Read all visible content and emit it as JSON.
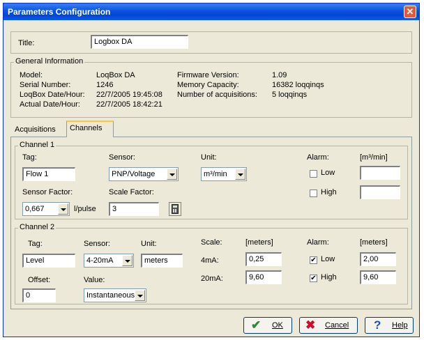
{
  "window": {
    "title": "Parameters Configuration"
  },
  "title_field": {
    "label": "Title:",
    "value": "Logbox DA"
  },
  "general": {
    "legend": "General Information",
    "model_label": "Model:",
    "model_value": "LoqBox DA",
    "serial_label": "Serial Number:",
    "serial_value": "1246",
    "logbox_dt_label": "LoqBox Date/Hour:",
    "logbox_dt_value": "22/7/2005 19:45:08",
    "actual_dt_label": "Actual Date/Hour:",
    "actual_dt_value": "22/7/2005 18:42:21",
    "firmware_label": "Firmware Version:",
    "firmware_value": "1.09",
    "memory_label": "Memory Capacity:",
    "memory_value": "16382 loqqinqs",
    "acq_label": "Number of acquisitions:",
    "acq_value": "5 loqqinqs"
  },
  "tabs": [
    {
      "label": "Acquisitions"
    },
    {
      "label": "Channels"
    }
  ],
  "channel1": {
    "legend": "Channel 1",
    "tag_label": "Tag:",
    "tag_value": "Flow 1",
    "sensor_label": "Sensor:",
    "sensor_value": "PNP/Voltage",
    "unit_label": "Unit:",
    "unit_value": "m³/min",
    "alarm_label": "Alarm:",
    "alarm_unit": "[m³/min]",
    "low_label": "Low",
    "low_value": "",
    "high_label": "High",
    "high_value": "",
    "sensor_factor_label": "Sensor Factor:",
    "sensor_factor_value": "0,667",
    "sensor_factor_unit": "l/pulse",
    "scale_factor_label": "Scale Factor:",
    "scale_factor_value": "3",
    "calc_icon": "calculator-icon"
  },
  "channel2": {
    "legend": "Channel 2",
    "tag_label": "Tag:",
    "tag_value": "Level",
    "sensor_label": "Sensor:",
    "sensor_value": "4-20mA",
    "unit_label": "Unit:",
    "unit_value": "meters",
    "scale_label": "Scale:",
    "scale_unit": "[meters]",
    "ma4_label": "4mA:",
    "ma4_value": "0,25",
    "ma20_label": "20mA:",
    "ma20_value": "9,60",
    "alarm_label": "Alarm:",
    "alarm_unit": "[meters]",
    "low_label": "Low",
    "low_value": "2,00",
    "high_label": "High",
    "high_value": "9,60",
    "offset_label": "Offset:",
    "offset_value": "0",
    "value_label": "Value:",
    "value_value": "Instantaneous"
  },
  "buttons": {
    "ok": "OK",
    "cancel": "Cancel",
    "help": "Help"
  },
  "colors": {
    "ok_icon": "#2e8b2e",
    "cancel_icon": "#c8102e",
    "help_icon": "#1f4fbf"
  }
}
